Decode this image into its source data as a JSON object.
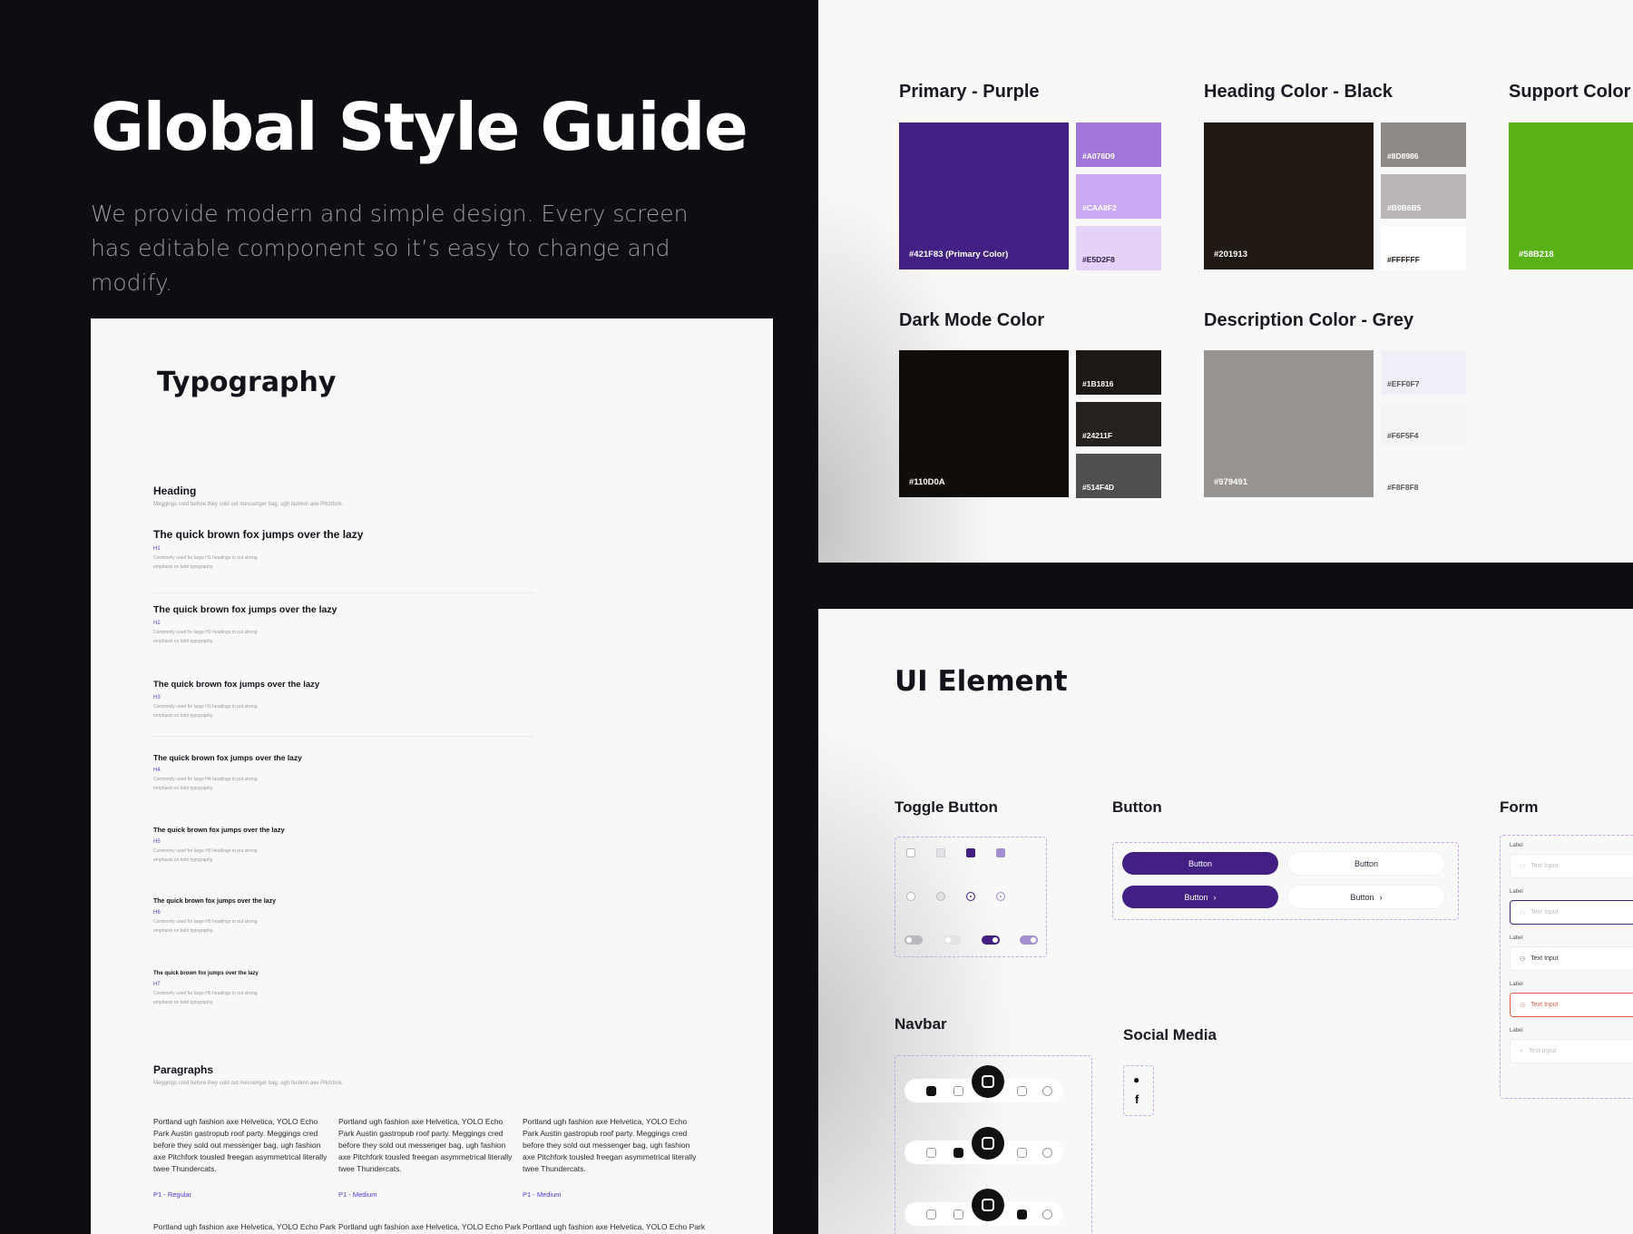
{
  "hero": {
    "title": "Global Style Guide",
    "subtitle": "We provide modern and simple design. Every screen has editable component so it’s easy to change and modify."
  },
  "typography": {
    "title": "Typography",
    "heading_section": "Heading",
    "heading_desc": "Meggings cred before they sold out messenger bag, ugh fashion axe Pitchfork.",
    "levels": [
      {
        "sample": "The quick brown fox jumps over the lazy",
        "tag": "H1",
        "note": "Commonly used for large H1 headings to put strong emphasis on bold typography."
      },
      {
        "sample": "The quick brown fox jumps over the lazy",
        "tag": "H2",
        "note": "Commonly used for large H2 headings to put strong emphasis on bold typography."
      },
      {
        "sample": "The quick brown fox jumps over the lazy",
        "tag": "H3",
        "note": "Commonly used for large H3 headings to put strong emphasis on bold typography."
      },
      {
        "sample": "The quick brown fox jumps over the lazy",
        "tag": "H4",
        "note": "Commonly used for large H4 headings to put strong emphasis on bold typography."
      },
      {
        "sample": "The quick brown fox jumps over the lazy",
        "tag": "H5",
        "note": "Commonly used for large H5 headings to put strong emphasis on bold typography."
      },
      {
        "sample": "The quick brown fox jumps over the lazy",
        "tag": "H6",
        "note": "Commonly used for large H6 headings to put strong emphasis on bold typography."
      },
      {
        "sample": "The quick brown fox jumps over the lazy",
        "tag": "H7",
        "note": "Commonly used for large H6 headings to put strong emphasis on bold typography."
      }
    ],
    "paragraph_section": "Paragraphs",
    "paragraph_desc": "Meggings cred before they sold out messenger bag, ugh fashion axe Pitchfork.",
    "paragraphs": [
      {
        "text": "Portland ugh fashion axe Helvetica, YOLO Echo Park Austin gastropub roof party. Meggings cred before they sold out messenger bag, ugh fashion axe Pitchfork tousled freegan asymmetrical literally twee Thundercats.",
        "tag": "P1 - Regular"
      },
      {
        "text": "Portland ugh fashion axe Helvetica, YOLO Echo Park Austin gastropub roof party. Meggings cred before they sold out messenger bag, ugh fashion axe Pitchfork tousled freegan asymmetrical literally twee Thundercats.",
        "tag": "P1 - Medium"
      },
      {
        "text": "Portland ugh fashion axe Helvetica, YOLO Echo Park Austin gastropub roof party. Meggings cred before they sold out messenger bag, ugh fashion axe Pitchfork tousled freegan asymmetrical literally twee Thundercats.",
        "tag": "P1 - Medium"
      }
    ],
    "paragraph_cut": [
      "Portland ugh fashion axe Helvetica, YOLO Echo Park",
      "Portland ugh fashion axe Helvetica, YOLO Echo Park",
      "Portland ugh fashion axe Helvetica, YOLO Echo Park"
    ]
  },
  "colors": {
    "primary": {
      "title": "Primary - Purple",
      "main": {
        "label": "#421F83 (Primary Color)",
        "hex": "#421F83"
      },
      "shades": [
        {
          "label": "#A076D9",
          "hex": "#A076D9"
        },
        {
          "label": "#CAA8F2",
          "hex": "#CAA8F2"
        },
        {
          "label": "#E5D2F8",
          "hex": "#E5D2F8"
        }
      ]
    },
    "heading": {
      "title": "Heading Color - Black",
      "main": {
        "label": "#201913",
        "hex": "#201913"
      },
      "shades": [
        {
          "label": "#8D8986",
          "hex": "#8D8986"
        },
        {
          "label": "#B9B6B5",
          "hex": "#B9B6B5"
        },
        {
          "label": "#FFFFFF",
          "hex": "#FFFFFF"
        }
      ]
    },
    "support": {
      "title": "Support Color",
      "main": {
        "label": "#58B218",
        "hex": "#58B218"
      }
    },
    "dark": {
      "title": "Dark Mode Color",
      "main": {
        "label": "#110D0A",
        "hex": "#110D0A"
      },
      "shades": [
        {
          "label": "#1B1816",
          "hex": "#1B1816"
        },
        {
          "label": "#24211F",
          "hex": "#24211F"
        },
        {
          "label": "#514F4D",
          "hex": "#514F4D"
        }
      ]
    },
    "grey": {
      "title": "Description Color - Grey",
      "main": {
        "label": "#979491",
        "hex": "#979491"
      },
      "shades": [
        {
          "label": "#EFF0F7",
          "hex": "#EFF0F7"
        },
        {
          "label": "#F6F5F4",
          "hex": "#F6F5F4"
        },
        {
          "label": "#F8F8F8",
          "hex": "#F8F8F8"
        }
      ]
    }
  },
  "ui": {
    "title": "UI Element",
    "toggle_title": "Toggle Button",
    "button_title": "Button",
    "form_title": "Form",
    "navbar_title": "Navbar",
    "social_title": "Social Media",
    "button_label": "Button",
    "form_label": "Label",
    "form_placeholder": "Text Input",
    "icons": {
      "social_1": "apple-icon",
      "social_2": "facebook-icon",
      "chevron": "chevron-right-icon"
    }
  },
  "palette": {
    "accent": "#421F83",
    "dashed": "#C6A6EA",
    "error": "#E05A4A"
  }
}
